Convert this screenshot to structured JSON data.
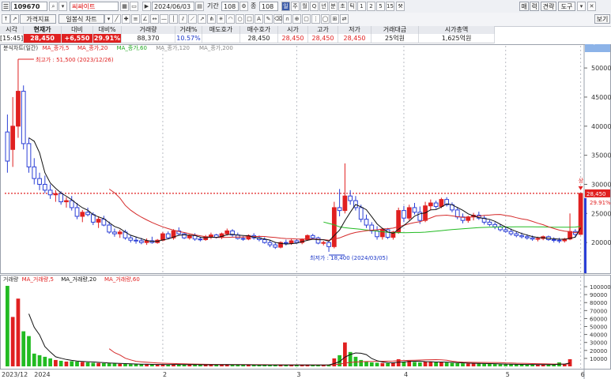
{
  "toolbar": {
    "stock_code": "109670",
    "stock_name": "씨싸이트",
    "date": "2024/06/03",
    "period_label": "기간",
    "period_value": "108",
    "count_label": "종",
    "count_value": "108",
    "period_buttons": [
      "일",
      "주",
      "월",
      "Q",
      "년",
      "분",
      "초",
      "틱",
      "1",
      "2",
      "5",
      "15"
    ],
    "right_buttons": [
      "매",
      "력",
      "견략",
      "도구"
    ],
    "view_label": "보기",
    "price_label_button": "가격지표",
    "chart_type": "일봉식 차트"
  },
  "quote": {
    "time": "[15:45]",
    "columns": [
      {
        "header": "시각",
        "value": "[15:45]"
      },
      {
        "header": "현재가",
        "value": "28,450"
      },
      {
        "header": "대비",
        "value": "+6,550"
      },
      {
        "header": "대비%",
        "value": "29.91%"
      },
      {
        "header": "거래량",
        "value": "88,370"
      },
      {
        "header": "거래%",
        "value": "10.57%"
      },
      {
        "header": "매도호가",
        "value": ""
      },
      {
        "header": "매수호가",
        "value": "28,450"
      },
      {
        "header": "시가",
        "value": "28,450"
      },
      {
        "header": "고가",
        "value": "28,450"
      },
      {
        "header": "저가",
        "value": "28,450"
      },
      {
        "header": "거래대금",
        "value": "25억원"
      },
      {
        "header": "시가총액",
        "value": "1,625억원"
      }
    ]
  },
  "price_panel": {
    "legend": [
      "분식차트(일간)",
      "MA_종가,5",
      "MA_종가,20",
      "MA_종가,60",
      "MA_종가,120",
      "MA_종가,200"
    ],
    "high_annotation": "최고가 : 51,500 (2023/12/26)",
    "low_annotation": "최저가 : 18,400 (2024/03/05)",
    "current_price": "28,450",
    "current_pct": "29.91%",
    "marker": "상",
    "y_ticks": [
      "50000",
      "45000",
      "40000",
      "35000",
      "30000",
      "25000",
      "20000"
    ]
  },
  "volume_panel": {
    "legend": [
      "거래량",
      "MA_거래량,5",
      "MA_거래량,20",
      "MA_거래량,60"
    ],
    "y_ticks": [
      "100000",
      "90000",
      "80000",
      "70000",
      "60000",
      "50000",
      "40000",
      "30000",
      "20000",
      "10000"
    ],
    "current_volume": "88,370",
    "current_pct": "10.57%"
  },
  "x_axis": {
    "labels": [
      "2023/12",
      "2024",
      "2",
      "3",
      "4",
      "5",
      "6"
    ]
  },
  "colors": {
    "up": "#e02020",
    "down": "#2b3fd6",
    "ma5": "#111111",
    "ma20": "#d52b2b",
    "ma60": "#22bb22",
    "axis": "#444444"
  },
  "chart_data": {
    "type": "candlestick",
    "ylim": [
      15000,
      53000
    ],
    "volume_ylim": [
      0,
      105000
    ],
    "candles": [
      [
        39000,
        42000,
        32000,
        34000
      ],
      [
        36000,
        45000,
        33000,
        40000
      ],
      [
        40000,
        51500,
        38000,
        46000
      ],
      [
        46000,
        47000,
        36000,
        37000
      ],
      [
        37000,
        38000,
        32000,
        33000
      ],
      [
        33000,
        34500,
        30000,
        31000
      ],
      [
        31000,
        32000,
        29000,
        30000
      ],
      [
        30000,
        31500,
        28500,
        29000
      ],
      [
        29000,
        30000,
        27500,
        28200
      ],
      [
        28200,
        29000,
        27000,
        28400
      ],
      [
        28400,
        28800,
        26500,
        27000
      ],
      [
        27000,
        27800,
        26000,
        27200
      ],
      [
        27200,
        28000,
        25500,
        26000
      ],
      [
        26000,
        26800,
        24000,
        24500
      ],
      [
        24500,
        25600,
        23500,
        25200
      ],
      [
        25200,
        26000,
        24500,
        24800
      ],
      [
        24800,
        25200,
        23000,
        23500
      ],
      [
        23500,
        24500,
        22500,
        24000
      ],
      [
        24000,
        24600,
        22800,
        23000
      ],
      [
        23000,
        23600,
        21500,
        21800
      ],
      [
        21800,
        22400,
        21000,
        21500
      ],
      [
        21500,
        22200,
        20800,
        21800
      ],
      [
        21800,
        22200,
        20500,
        20800
      ],
      [
        20800,
        21300,
        20000,
        20400
      ],
      [
        20400,
        21000,
        19800,
        20300
      ],
      [
        20300,
        20800,
        19700,
        20000
      ],
      [
        20000,
        20700,
        19600,
        20300
      ],
      [
        20300,
        21000,
        19800,
        20000
      ],
      [
        20000,
        20600,
        19800,
        20400
      ],
      [
        20400,
        21800,
        20200,
        21500
      ],
      [
        21500,
        21900,
        20600,
        20800
      ],
      [
        20800,
        22300,
        20500,
        22000
      ],
      [
        22000,
        22600,
        21200,
        21500
      ],
      [
        21500,
        21700,
        20600,
        20800
      ],
      [
        20800,
        21400,
        20500,
        21200
      ],
      [
        21200,
        21600,
        20300,
        20600
      ],
      [
        20600,
        21000,
        20200,
        20500
      ],
      [
        20500,
        21300,
        20300,
        21000
      ],
      [
        21000,
        21700,
        20600,
        21300
      ],
      [
        21300,
        21500,
        20700,
        20900
      ],
      [
        20900,
        21700,
        20600,
        21500
      ],
      [
        21500,
        22400,
        21200,
        22000
      ],
      [
        22000,
        22300,
        21000,
        21300
      ],
      [
        21300,
        21700,
        20500,
        20700
      ],
      [
        20700,
        21100,
        20300,
        20600
      ],
      [
        20600,
        21400,
        20400,
        21200
      ],
      [
        21200,
        21600,
        20500,
        20800
      ],
      [
        20800,
        21200,
        20200,
        20500
      ],
      [
        20500,
        20900,
        19800,
        20000
      ],
      [
        20000,
        20400,
        19200,
        19600
      ],
      [
        19600,
        20000,
        18900,
        19200
      ],
      [
        19200,
        20200,
        19000,
        20000
      ],
      [
        20000,
        20500,
        19500,
        19900
      ],
      [
        19900,
        20600,
        19600,
        20300
      ],
      [
        20300,
        20600,
        19800,
        20000
      ],
      [
        20000,
        20700,
        19700,
        20500
      ],
      [
        20500,
        21400,
        20300,
        21200
      ],
      [
        21200,
        21500,
        20600,
        20800
      ],
      [
        20800,
        21000,
        19700,
        19900
      ],
      [
        19900,
        20300,
        19500,
        20000
      ],
      [
        20000,
        20200,
        18400,
        19300
      ],
      [
        19300,
        27000,
        19000,
        26000
      ],
      [
        26000,
        29200,
        24500,
        25500
      ],
      [
        25500,
        33600,
        25000,
        28000
      ],
      [
        28000,
        29000,
        26500,
        27200
      ],
      [
        27200,
        28000,
        25500,
        26000
      ],
      [
        26000,
        26500,
        23500,
        24000
      ],
      [
        24000,
        24800,
        22500,
        23000
      ],
      [
        23000,
        23500,
        21500,
        22000
      ],
      [
        22000,
        22800,
        20500,
        21000
      ],
      [
        21000,
        22500,
        20500,
        22200
      ],
      [
        22200,
        22500,
        20600,
        20900
      ],
      [
        20900,
        22000,
        20500,
        21800
      ],
      [
        21800,
        26000,
        21500,
        25500
      ],
      [
        25500,
        26300,
        23500,
        24200
      ],
      [
        24200,
        26500,
        23800,
        26000
      ],
      [
        26000,
        26800,
        24800,
        25200
      ],
      [
        25200,
        26200,
        23200,
        23800
      ],
      [
        23800,
        27000,
        23500,
        26300
      ],
      [
        26300,
        27400,
        25500,
        26800
      ],
      [
        26800,
        27200,
        25800,
        26200
      ],
      [
        26200,
        27700,
        25900,
        27400
      ],
      [
        27400,
        27800,
        26200,
        26500
      ],
      [
        26500,
        26900,
        25200,
        25600
      ],
      [
        25600,
        26100,
        24000,
        24400
      ],
      [
        24400,
        25000,
        23300,
        23800
      ],
      [
        23800,
        24600,
        23400,
        24400
      ],
      [
        24400,
        25100,
        23800,
        24700
      ],
      [
        24700,
        25300,
        23900,
        24200
      ],
      [
        24200,
        24600,
        23100,
        23500
      ],
      [
        23500,
        23900,
        22800,
        23100
      ],
      [
        23100,
        23500,
        22300,
        22700
      ],
      [
        22700,
        23100,
        21900,
        22200
      ],
      [
        22200,
        22700,
        21700,
        21900
      ],
      [
        21900,
        22400,
        21200,
        21500
      ],
      [
        21500,
        21900,
        20900,
        21200
      ],
      [
        21200,
        21700,
        20700,
        21000
      ],
      [
        21000,
        21400,
        20500,
        20800
      ],
      [
        20800,
        21200,
        20300,
        20600
      ],
      [
        20600,
        21000,
        20200,
        20700
      ],
      [
        20700,
        21200,
        20400,
        21000
      ],
      [
        21000,
        21200,
        20300,
        20500
      ],
      [
        20500,
        20900,
        20000,
        20400
      ],
      [
        20400,
        20800,
        19900,
        20300
      ],
      [
        20300,
        20800,
        20000,
        20600
      ],
      [
        20600,
        25000,
        20400,
        21900
      ],
      [
        21900,
        22300,
        21000,
        21400
      ],
      [
        21400,
        28450,
        21300,
        28450
      ]
    ],
    "volume": [
      101000,
      62000,
      85000,
      44000,
      38000,
      16000,
      14000,
      12000,
      10000,
      8000,
      7000,
      6000,
      6500,
      6000,
      5500,
      5000,
      4500,
      4200,
      4000,
      3800,
      3500,
      3200,
      3000,
      2800,
      2600,
      2500,
      2400,
      2300,
      2200,
      2400,
      2200,
      2600,
      2300,
      2100,
      2000,
      2000,
      1900,
      2100,
      2200,
      2000,
      2100,
      2300,
      2000,
      1900,
      1800,
      1900,
      1800,
      1700,
      1700,
      1600,
      1600,
      1700,
      1600,
      1700,
      1600,
      1700,
      1900,
      1800,
      1700,
      1600,
      2200,
      10000,
      14000,
      30000,
      18000,
      12000,
      8000,
      6000,
      5000,
      4500,
      4200,
      4000,
      4500,
      9000,
      6000,
      7000,
      5500,
      5000,
      6000,
      5500,
      5000,
      5500,
      4800,
      4300,
      4000,
      3800,
      3600,
      3800,
      3500,
      3300,
      3100,
      2900,
      2700,
      2600,
      2500,
      2400,
      2300,
      2300,
      2400,
      2200,
      2100,
      2000,
      2100,
      5000,
      3000,
      9000
    ],
    "ma5": [],
    "ma20": [],
    "ma60": []
  }
}
